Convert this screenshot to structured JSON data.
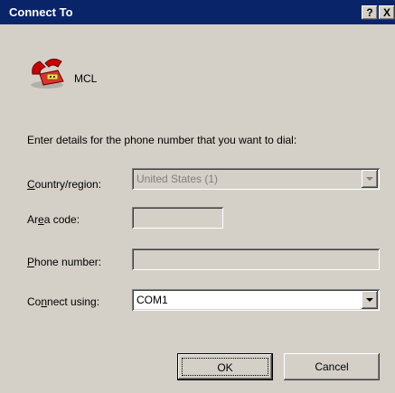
{
  "window": {
    "title": "Connect To",
    "help_label": "?",
    "close_label": "X"
  },
  "connection": {
    "name": "MCL",
    "icon": "telephone-icon"
  },
  "prompt": "Enter details for the phone number that you want to dial:",
  "fields": {
    "country": {
      "label_prefix": "",
      "label_key": "C",
      "label_rest": "ountry/region:",
      "value": "United States (1)"
    },
    "area": {
      "label_prefix": "Ar",
      "label_key": "e",
      "label_rest": "a code:",
      "value": ""
    },
    "phone": {
      "label_prefix": "",
      "label_key": "P",
      "label_rest": "hone number:",
      "value": ""
    },
    "connect": {
      "label_prefix": "Co",
      "label_key": "n",
      "label_rest": "nect using:",
      "value": "COM1"
    }
  },
  "buttons": {
    "ok": "OK",
    "cancel": "Cancel"
  },
  "colors": {
    "titlebar": "#0a246a",
    "face": "#d4d0c8"
  }
}
